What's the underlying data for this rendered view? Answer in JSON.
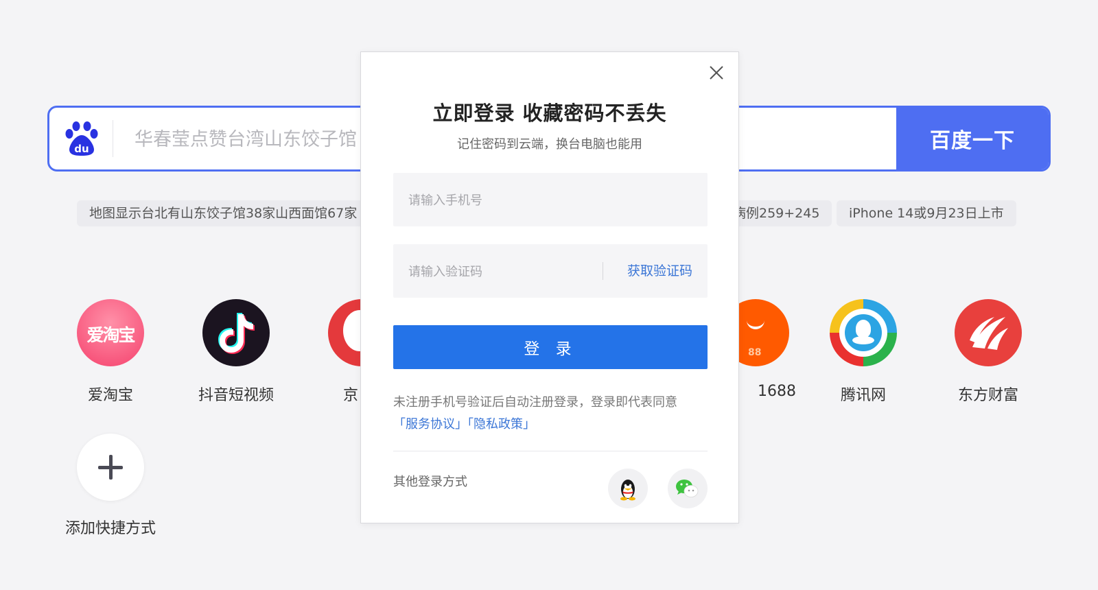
{
  "search": {
    "placeholder": "华春莹点赞台湾山东饺子馆",
    "button_label": "百度一下"
  },
  "hot_chips": [
    "地图显示台北有山东饺子馆38家山西面馆67家",
    "病例259+245",
    "iPhone 14或9月23日上市"
  ],
  "shortcuts": [
    {
      "label": "爱淘宝",
      "logo_text": "爱淘宝",
      "icon": "aitaobao-icon"
    },
    {
      "label": "抖音短视频",
      "icon": "douyin-icon"
    },
    {
      "label": "京",
      "icon": "jd-icon"
    },
    {
      "label": "1688",
      "logo_text": "88",
      "icon": "1688-icon"
    },
    {
      "label": "腾讯网",
      "icon": "tencent-icon"
    },
    {
      "label": "东方财富",
      "icon": "eastmoney-icon"
    },
    {
      "label": "添加快捷方式",
      "icon": "plus-icon"
    }
  ],
  "login_modal": {
    "title": "立即登录 收藏密码不丢失",
    "subtitle": "记住密码到云端，换台电脑也能用",
    "phone_placeholder": "请输入手机号",
    "code_placeholder": "请输入验证码",
    "get_code_label": "获取验证码",
    "login_label": "登 录",
    "notice_text": "未注册手机号验证后自动注册登录，登录即代表同意",
    "terms_link": "「服务协议」",
    "privacy_link": "「隐私政策」",
    "other_login_label": "其他登录方式",
    "social": [
      {
        "icon": "qq-icon"
      },
      {
        "icon": "wechat-icon"
      }
    ]
  },
  "colors": {
    "brand_blue": "#4e6ef2",
    "login_blue": "#2473e8",
    "link_blue": "#3b76d6",
    "background": "#f4f4f6"
  }
}
